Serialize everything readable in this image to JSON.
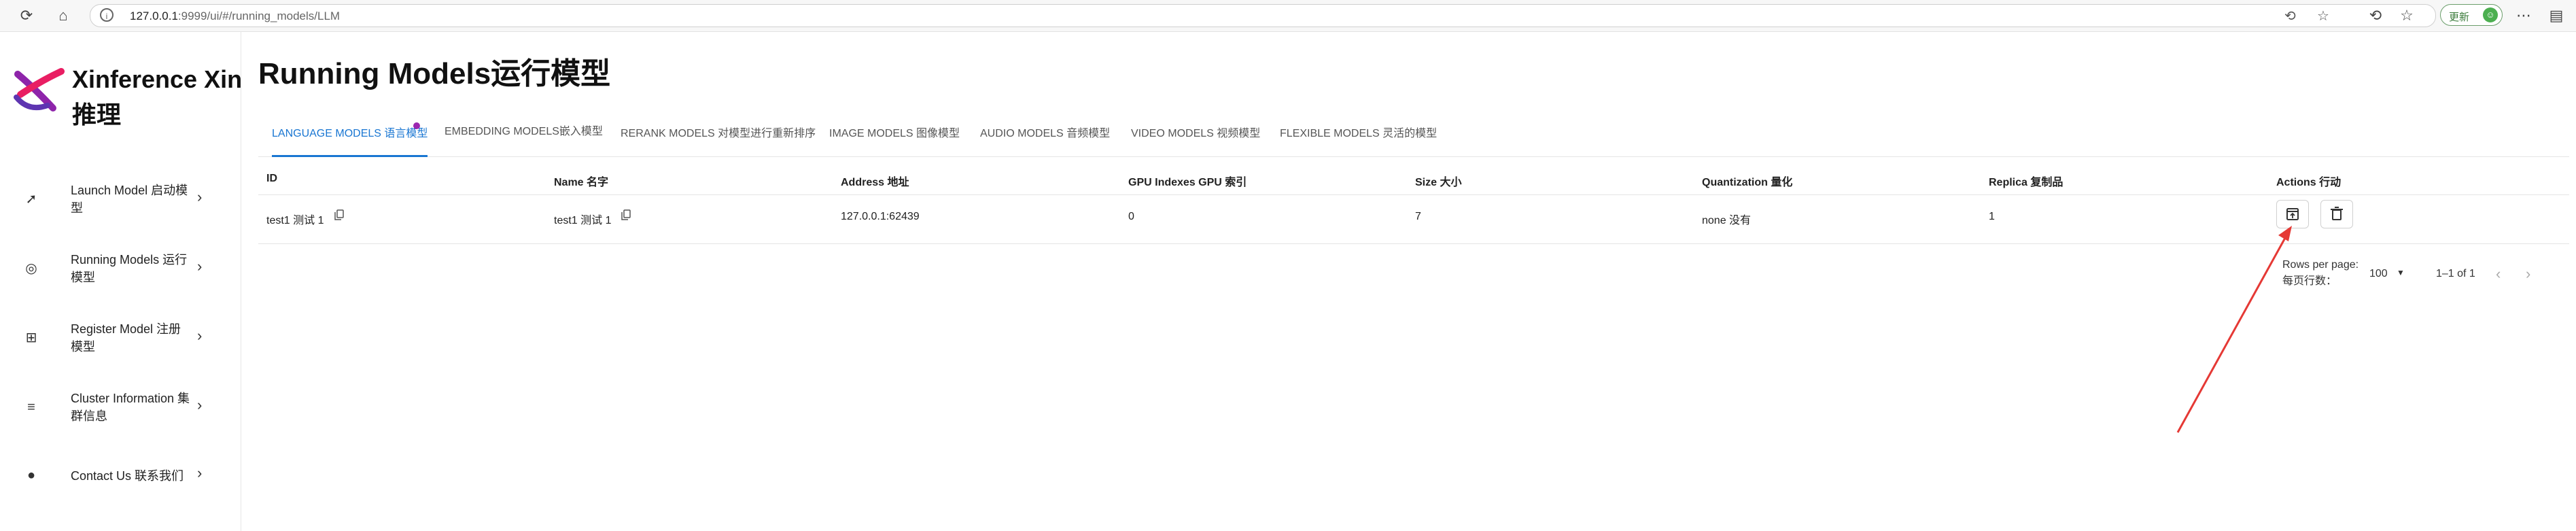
{
  "browser": {
    "url_host": "127.0.0.1",
    "url_rest": ":9999/ui/#/running_models/LLM",
    "update_label": "更新",
    "icons": [
      "refresh-icon",
      "home-icon",
      "info-icon",
      "translate-icon",
      "star-icon",
      "extensions-icon",
      "favorites-icon",
      "collections-icon",
      "more-icon",
      "sidebar-icon"
    ]
  },
  "sidebar": {
    "brand": "Xinference Xin",
    "brand_line2": "推理",
    "items": [
      {
        "label": "Launch Model 启动模型",
        "icon": "rocket-icon"
      },
      {
        "label": "Running Models 运行模型",
        "icon": "robot-icon"
      },
      {
        "label": "Register Model 注册模型",
        "icon": "add-box-icon"
      },
      {
        "label": "Cluster Information 集群信息",
        "icon": "storage-icon"
      },
      {
        "label": "Contact Us 联系我们",
        "icon": "github-icon"
      }
    ]
  },
  "main": {
    "title": "Running Models运行模型",
    "tabs": [
      {
        "label": "LANGUAGE MODELS 语言模型",
        "active": true
      },
      {
        "label": "EMBEDDING MODELS嵌入模型"
      },
      {
        "label": "RERANK MODELS 对模型进行重新排序"
      },
      {
        "label": "IMAGE MODELS 图像模型"
      },
      {
        "label": "AUDIO MODELS 音频模型"
      },
      {
        "label": "VIDEO MODELS 视频模型"
      },
      {
        "label": "FLEXIBLE MODELS 灵活的模型"
      }
    ],
    "table": {
      "headers": [
        "ID",
        "Name 名字",
        "Address 地址",
        "GPU Indexes GPU 索引",
        "Size 大小",
        "Quantization 量化",
        "Replica 复制品",
        "Actions 行动"
      ],
      "rows": [
        {
          "id": "test1 测试 1",
          "name": "test1 测试 1",
          "address": "127.0.0.1:62439",
          "gpu": "0",
          "size": "7",
          "quantization": "none 没有",
          "replica": "1"
        }
      ]
    },
    "pagination": {
      "rows_per_page": "Rows per page:",
      "rows_per_page_cn": "每页行数：",
      "value": "100",
      "range": "1–1 of 1"
    }
  },
  "colors": {
    "accent": "#1976d2",
    "annotation": "#e53935"
  }
}
